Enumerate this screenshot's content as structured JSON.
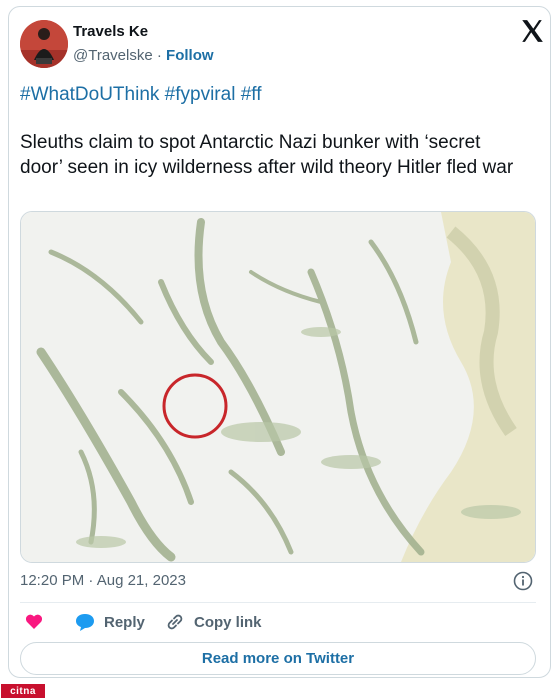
{
  "author": {
    "display_name": "Travels Ke",
    "handle": "@Travelske",
    "separator": "·",
    "follow_label": "Follow"
  },
  "hashtags": [
    "#WhatDoUThink",
    "#fypviral",
    "#ff"
  ],
  "tweet_text": "Sleuths claim to spot Antarctic Nazi bunker with ‘secret door’ seen in icy wilderness after wild theory Hitler fled war",
  "media": {
    "alt": "satellite image of icy terrain with a red circle",
    "highlight_color": "#c8262a"
  },
  "meta": {
    "time": "12:20 PM",
    "separator": "·",
    "date": "Aug 21, 2023"
  },
  "actions": {
    "like_icon": "heart-icon",
    "reply_label": "Reply",
    "copy_label": "Copy link"
  },
  "read_more_label": "Read more on Twitter",
  "watermark": "citna",
  "colors": {
    "link": "#1d6fa5",
    "heart": "#f91880",
    "reply": "#1d9bf0",
    "muted": "#536471"
  }
}
